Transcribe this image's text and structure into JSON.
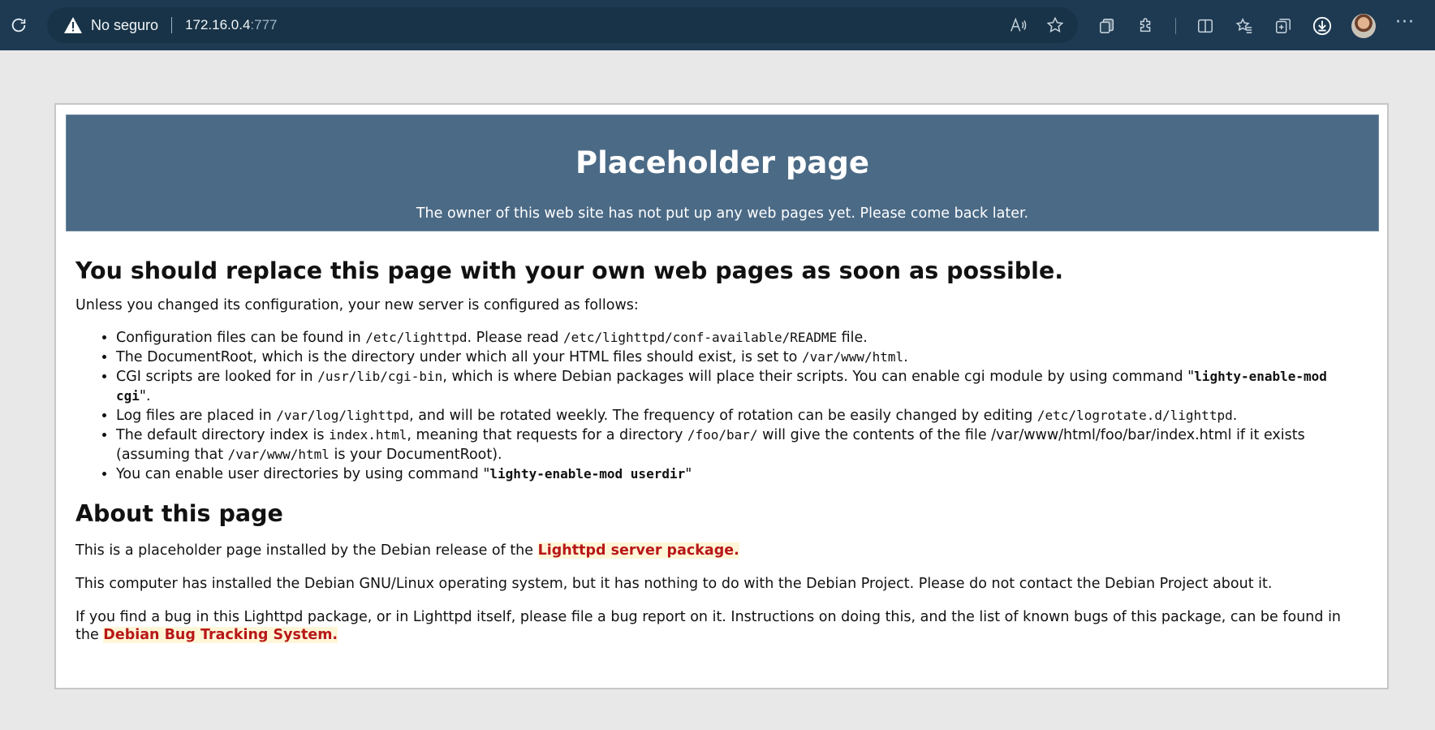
{
  "browser": {
    "security_label": "No seguro",
    "url_host": "172.16.0.4",
    "url_port": ":777",
    "icons": [
      "reload-icon",
      "warning-icon",
      "read-aloud-icon",
      "favorite-star-icon",
      "collections-icon",
      "extensions-icon",
      "split-screen-icon",
      "favorites-icon",
      "tab-collections-icon",
      "downloads-icon",
      "profile-avatar",
      "more-icon"
    ],
    "more_label": "···"
  },
  "banner": {
    "title": "Placeholder page",
    "subtitle": "The owner of this web site has not put up any web pages yet. Please come back later."
  },
  "main": {
    "heading": "You should replace this page with your own web pages as soon as possible.",
    "intro": "Unless you changed its configuration, your new server is configured as follows:",
    "items": {
      "config": {
        "t1": "Configuration files can be found in ",
        "c1": "/etc/lighttpd",
        "t2": ". Please read ",
        "c2": "/etc/lighttpd/conf-available/README",
        "t3": " file."
      },
      "docroot": {
        "t1": "The DocumentRoot, which is the directory under which all your HTML files should exist, is set to ",
        "c1": "/var/www/html",
        "t2": "."
      },
      "cgi": {
        "t1": "CGI scripts are looked for in ",
        "c1": "/usr/lib/cgi-bin",
        "t2": ", which is where Debian packages will place their scripts. You can enable cgi module by using command \"",
        "b1": "lighty-enable-mod cgi",
        "t3": "\"."
      },
      "logs": {
        "t1": "Log files are placed in ",
        "c1": "/var/log/lighttpd",
        "t2": ", and will be rotated weekly. The frequency of rotation can be easily changed by editing ",
        "c2": "/etc/logrotate.d/lighttpd",
        "t3": "."
      },
      "index": {
        "t1": "The default directory index is ",
        "c1": "index.html",
        "t2": ", meaning that requests for a directory ",
        "c2": "/foo/bar/",
        "t3": " will give the contents of the file /var/www/html/foo/bar/index.html if it exists (assuming that ",
        "c3": "/var/www/html",
        "t4": " is your DocumentRoot)."
      },
      "userdir": {
        "t1": "You can enable user directories by using command \"",
        "b1": "lighty-enable-mod userdir",
        "t2": "\""
      }
    },
    "about_heading": "About this page",
    "about_p1_text": "This is a placeholder page installed by the Debian release of the ",
    "about_p1_link": "Lighttpd server package.",
    "about_p2": "This computer has installed the Debian GNU/Linux operating system, but it has nothing to do with the Debian Project. Please do not contact the Debian Project about it.",
    "about_p3_text": "If you find a bug in this Lighttpd package, or in Lighttpd itself, please file a bug report on it. Instructions on doing this, and the list of known bugs of this package, can be found in the ",
    "about_p3_link": "Debian Bug Tracking System."
  },
  "colors": {
    "chrome_bg": "#1e3a52",
    "banner_bg": "#4b6a86",
    "link_color": "#b81818",
    "link_highlight": "#fff6d8"
  }
}
